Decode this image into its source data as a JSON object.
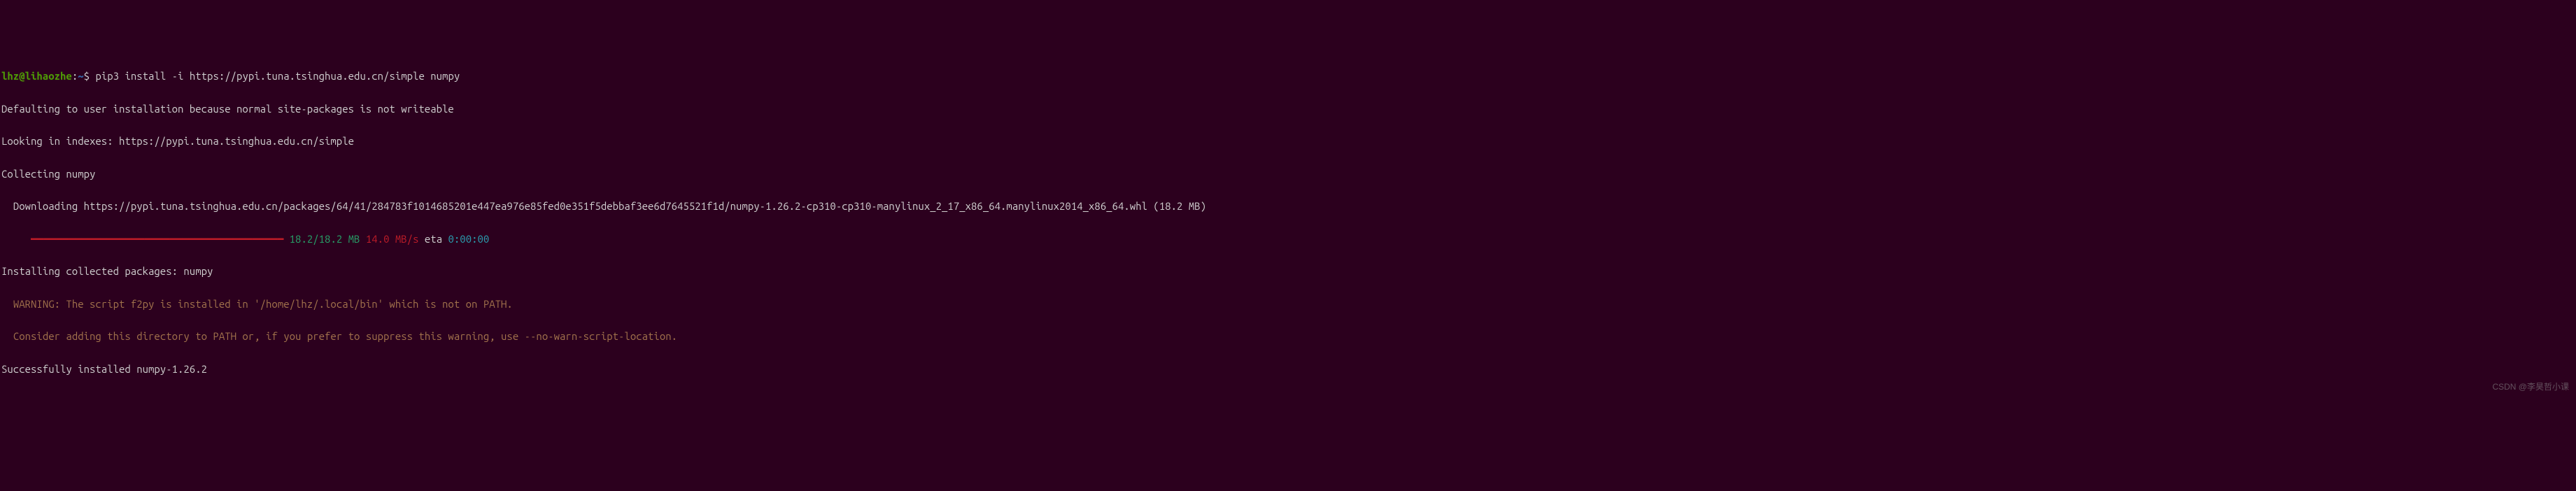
{
  "prompt": {
    "user": "lhz",
    "host": "lihaozhe",
    "path": "~",
    "command": "pip3 install -i https://pypi.tuna.tsinghua.edu.cn/simple numpy"
  },
  "output": {
    "line1": "Defaulting to user installation because normal site-packages is not writeable",
    "line2": "Looking in indexes: https://pypi.tuna.tsinghua.edu.cn/simple",
    "line3": "Collecting numpy",
    "line4": "  Downloading https://pypi.tuna.tsinghua.edu.cn/packages/64/41/284783f1014685201e447ea976e85fed0e351f5debbaf3ee6d7645521f1d/numpy-1.26.2-cp310-cp310-manylinux_2_17_x86_64.manylinux2014_x86_64.whl (18.2 MB)",
    "progress": {
      "indent": "     ",
      "bar": "━━━━━━━━━━━━━━━━━━━━━━━━━━━━━━━━━━━━━━━━",
      "size": "18.2/18.2 MB",
      "rate": "14.0 MB/s",
      "eta_label": "eta",
      "eta_time": "0:00:00"
    },
    "line6": "Installing collected packages: numpy",
    "warning1": "  WARNING: The script f2py is installed in '/home/lhz/.local/bin' which is not on PATH.",
    "warning2": "  Consider adding this directory to PATH or, if you prefer to suppress this warning, use --no-warn-script-location.",
    "line9": "Successfully installed numpy-1.26.2"
  },
  "watermark": "CSDN @李昊哲小课"
}
